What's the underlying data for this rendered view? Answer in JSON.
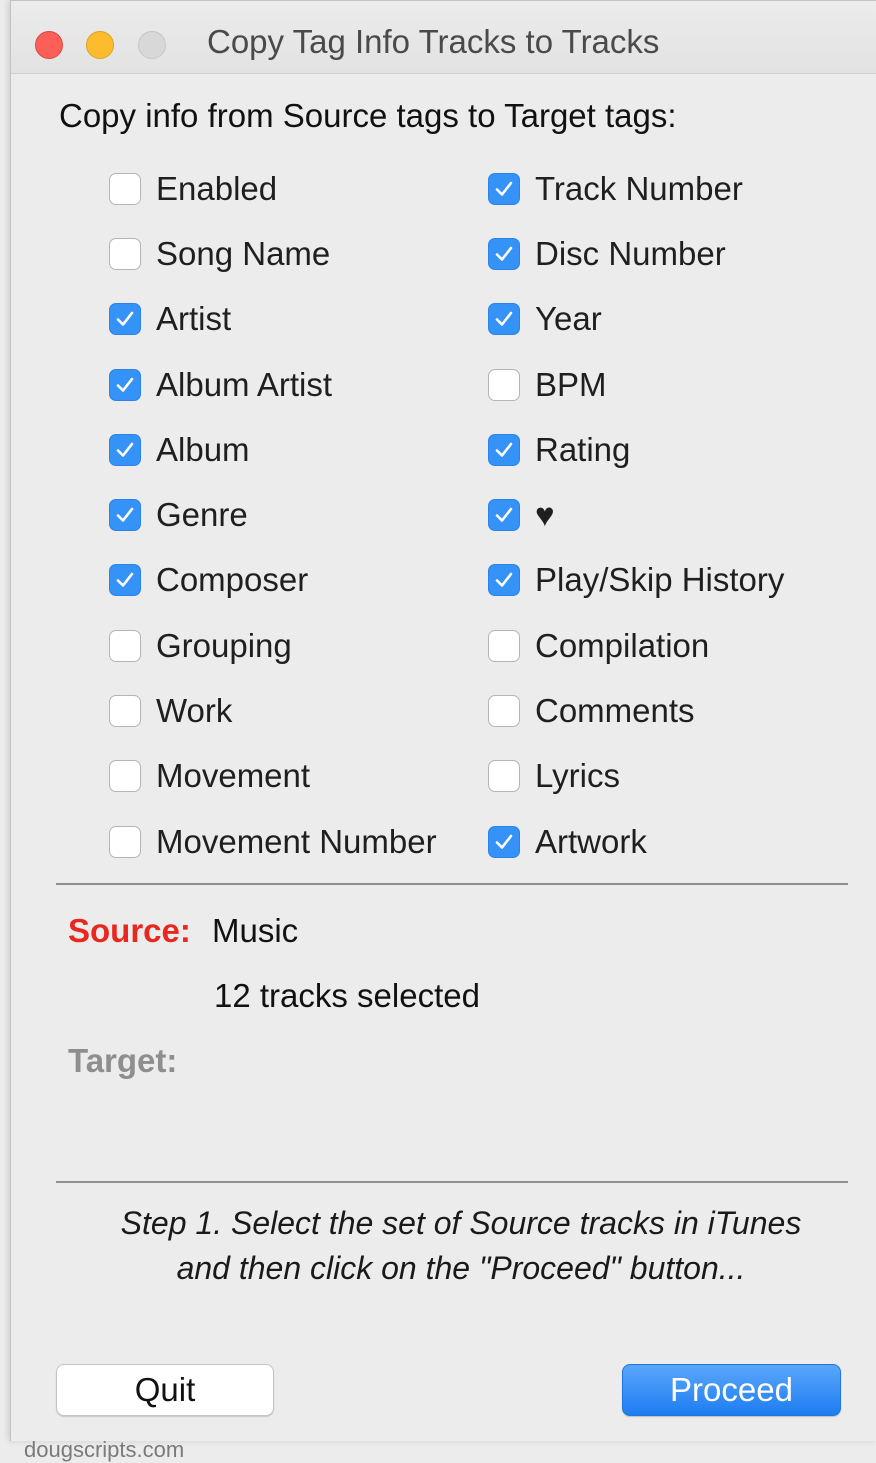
{
  "window": {
    "title": "Copy Tag Info Tracks to Tracks"
  },
  "heading": "Copy info from Source tags to Target tags:",
  "options": {
    "left": [
      {
        "label": "Enabled",
        "checked": false
      },
      {
        "label": "Song Name",
        "checked": false
      },
      {
        "label": "Artist",
        "checked": true
      },
      {
        "label": "Album Artist",
        "checked": true
      },
      {
        "label": "Album",
        "checked": true
      },
      {
        "label": "Genre",
        "checked": true
      },
      {
        "label": "Composer",
        "checked": true
      },
      {
        "label": "Grouping",
        "checked": false
      },
      {
        "label": "Work",
        "checked": false
      },
      {
        "label": "Movement",
        "checked": false
      },
      {
        "label": "Movement Number",
        "checked": false
      }
    ],
    "right": [
      {
        "label": "Track Number",
        "checked": true
      },
      {
        "label": "Disc Number",
        "checked": true
      },
      {
        "label": "Year",
        "checked": true
      },
      {
        "label": "BPM",
        "checked": false
      },
      {
        "label": "Rating",
        "checked": true
      },
      {
        "label": "♥",
        "checked": true
      },
      {
        "label": "Play/Skip History",
        "checked": true
      },
      {
        "label": "Compilation",
        "checked": false
      },
      {
        "label": "Comments",
        "checked": false
      },
      {
        "label": "Lyrics",
        "checked": false
      },
      {
        "label": "Artwork",
        "checked": true
      }
    ]
  },
  "source": {
    "label": "Source:",
    "value": "Music",
    "tracks": "12 tracks selected"
  },
  "target": {
    "label": "Target:"
  },
  "instructions": {
    "line1": "Step 1. Select the set of Source tracks in iTunes",
    "line2": "and then click on the \"Proceed\" button..."
  },
  "buttons": {
    "quit": "Quit",
    "proceed": "Proceed"
  },
  "footer": "dougscripts.com",
  "colors": {
    "accent": "#3592f7",
    "source_label": "#e8281e",
    "target_label": "#8e8e8e"
  }
}
